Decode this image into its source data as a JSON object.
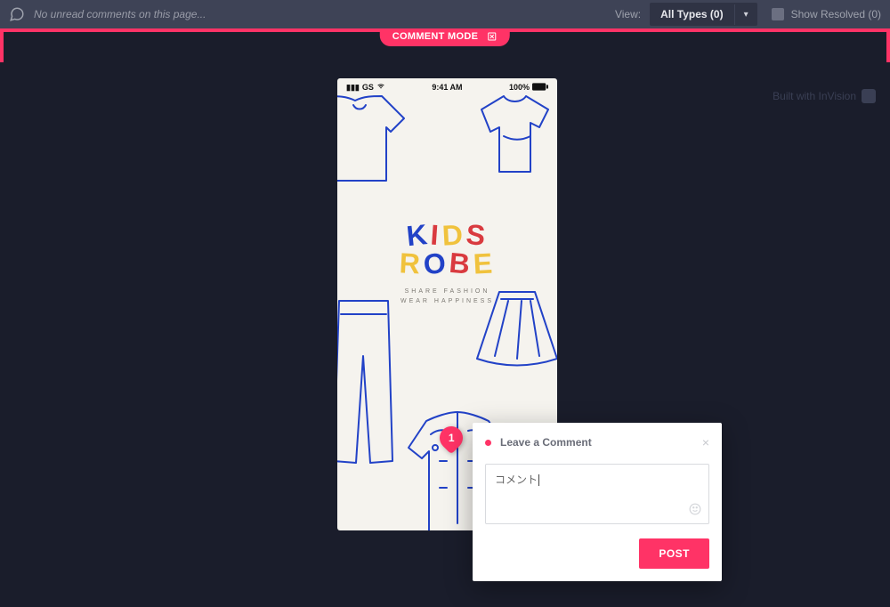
{
  "topbar": {
    "unread_text": "No unread comments on this page...",
    "view_label": "View:",
    "types_label": "All Types (0)",
    "show_resolved_label": "Show Resolved (0)"
  },
  "comment_mode": {
    "label": "COMMENT MODE"
  },
  "phone": {
    "statusbar": {
      "carrier": "GS",
      "time": "9:41 AM",
      "battery": "100%"
    },
    "logo": {
      "line1": [
        "K",
        "I",
        "D",
        "S"
      ],
      "line2": [
        "R",
        "O",
        "B",
        "E"
      ],
      "tagline1": "SHARE FASHION",
      "tagline2": "WEAR HAPPINESS"
    }
  },
  "pin": {
    "number": "1"
  },
  "popover": {
    "title": "Leave a Comment",
    "input_value": "コメント",
    "post_label": "POST"
  },
  "built_with": {
    "text": "Built with InVision"
  }
}
